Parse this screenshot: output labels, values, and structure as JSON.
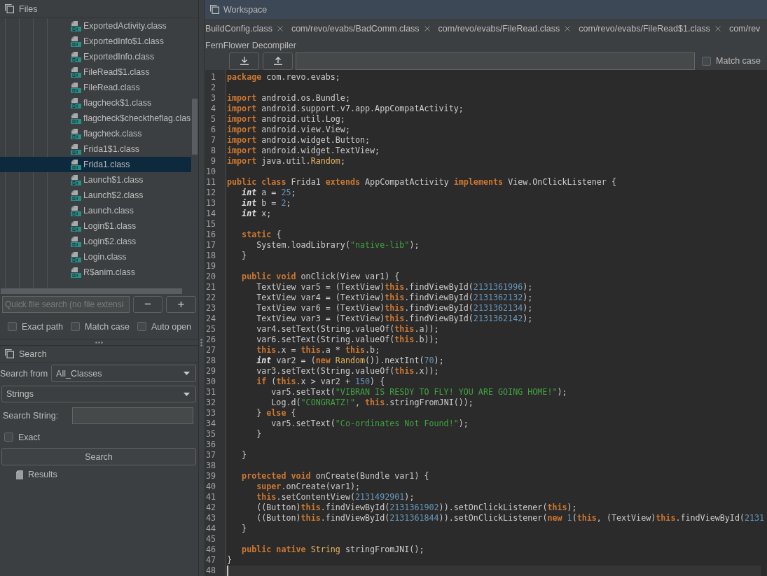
{
  "files_panel": {
    "title": "Files",
    "tree_items": [
      {
        "label": "ExportedActivity.class",
        "selected": false
      },
      {
        "label": "ExportedInfo$1.class",
        "selected": false
      },
      {
        "label": "ExportedInfo.class",
        "selected": false
      },
      {
        "label": "FileRead$1.class",
        "selected": false
      },
      {
        "label": "FileRead.class",
        "selected": false
      },
      {
        "label": "flagcheck$1.class",
        "selected": false
      },
      {
        "label": "flagcheck$checktheflag.clas",
        "selected": false
      },
      {
        "label": "flagcheck.class",
        "selected": false
      },
      {
        "label": "Frida1$1.class",
        "selected": false
      },
      {
        "label": "Frida1.class",
        "selected": true
      },
      {
        "label": "Launch$1.class",
        "selected": false
      },
      {
        "label": "Launch$2.class",
        "selected": false
      },
      {
        "label": "Launch.class",
        "selected": false
      },
      {
        "label": "Login$1.class",
        "selected": false
      },
      {
        "label": "Login$2.class",
        "selected": false
      },
      {
        "label": "Login.class",
        "selected": false
      },
      {
        "label": "R$anim.class",
        "selected": false
      }
    ],
    "quick_search": {
      "placeholder": "Quick file search (no file extensi"
    },
    "minus_button": "−",
    "plus_button": "+",
    "options": [
      {
        "label": "Exact path",
        "checked": false
      },
      {
        "label": "Match case",
        "checked": false
      },
      {
        "label": "Auto open",
        "checked": false
      }
    ]
  },
  "search_panel": {
    "title": "Search",
    "search_from": {
      "label": "Search from",
      "value": "All_Classes"
    },
    "search_type": {
      "value": "Strings"
    },
    "search_string": {
      "label": "Search String:"
    },
    "exact": {
      "label": "Exact",
      "checked": false
    },
    "search_button": "Search",
    "results": {
      "label": "Results"
    }
  },
  "workspace": {
    "title": "Workspace",
    "tabs": [
      {
        "label": "BuildConfig.class",
        "selected": false,
        "closable": true
      },
      {
        "label": "com/revo/evabs/BadComm.class",
        "selected": false,
        "closable": true
      },
      {
        "label": "com/revo/evabs/FileRead.class",
        "selected": false,
        "closable": true
      },
      {
        "label": "com/revo/evabs/FileRead$1.class",
        "selected": false,
        "closable": true
      },
      {
        "label": "com/rev",
        "selected": false,
        "closable": false
      }
    ],
    "decompiler": "FernFlower Decompiler",
    "match_case": {
      "label": "Match case",
      "checked": false
    },
    "code_lines": [
      {
        "number": "1",
        "current": false,
        "segments": [
          {
            "kind": "keyword",
            "text": "package"
          },
          {
            "kind": "plain",
            "text": " com.revo.evabs;"
          }
        ]
      },
      {
        "number": "2",
        "current": false
      },
      {
        "number": "3",
        "current": false,
        "segments": [
          {
            "kind": "keyword",
            "text": "import"
          },
          {
            "kind": "plain",
            "text": " android.os.Bundle;"
          }
        ]
      },
      {
        "number": "4",
        "current": false,
        "segments": [
          {
            "kind": "keyword",
            "text": "import"
          },
          {
            "kind": "plain",
            "text": " android.support.v7.app.AppCompatActivity;"
          }
        ]
      },
      {
        "number": "5",
        "current": false,
        "segments": [
          {
            "kind": "keyword",
            "text": "import"
          },
          {
            "kind": "plain",
            "text": " android.util.Log;"
          }
        ]
      },
      {
        "number": "6",
        "current": false,
        "segments": [
          {
            "kind": "keyword",
            "text": "import"
          },
          {
            "kind": "plain",
            "text": " android.view.View;"
          }
        ]
      },
      {
        "number": "7",
        "current": false,
        "segments": [
          {
            "kind": "keyword",
            "text": "import"
          },
          {
            "kind": "plain",
            "text": " android.widget.Button;"
          }
        ]
      },
      {
        "number": "8",
        "current": false,
        "segments": [
          {
            "kind": "keyword",
            "text": "import"
          },
          {
            "kind": "plain",
            "text": " android.widget.TextView;"
          }
        ]
      },
      {
        "number": "9",
        "current": false,
        "segments": [
          {
            "kind": "keyword",
            "text": "import"
          },
          {
            "kind": "plain",
            "text": " java.util."
          },
          {
            "kind": "class",
            "text": "Random"
          },
          {
            "kind": "plain",
            "text": ";"
          }
        ]
      },
      {
        "number": "10",
        "current": false
      },
      {
        "number": "11",
        "current": false,
        "segments": [
          {
            "kind": "keyword",
            "text": "public class"
          },
          {
            "kind": "plain",
            "text": " Frida1 "
          },
          {
            "kind": "keyword",
            "text": "extends"
          },
          {
            "kind": "plain",
            "text": " AppCompatActivity "
          },
          {
            "kind": "keyword",
            "text": "implements"
          },
          {
            "kind": "plain",
            "text": " View.OnClickListener {"
          }
        ]
      },
      {
        "number": "12",
        "current": false,
        "segments": [
          {
            "kind": "primitive",
            "text": "   int"
          },
          {
            "kind": "plain",
            "text": " a = "
          },
          {
            "kind": "number",
            "text": "25"
          },
          {
            "kind": "plain",
            "text": ";"
          }
        ]
      },
      {
        "number": "13",
        "current": false,
        "segments": [
          {
            "kind": "primitive",
            "text": "   int"
          },
          {
            "kind": "plain",
            "text": " b = "
          },
          {
            "kind": "number",
            "text": "2"
          },
          {
            "kind": "plain",
            "text": ";"
          }
        ]
      },
      {
        "number": "14",
        "current": false,
        "segments": [
          {
            "kind": "primitive",
            "text": "   int"
          },
          {
            "kind": "plain",
            "text": " x;"
          }
        ]
      },
      {
        "number": "15",
        "current": false
      },
      {
        "number": "16",
        "current": false,
        "segments": [
          {
            "kind": "keyword",
            "text": "   static"
          },
          {
            "kind": "plain",
            "text": " {"
          }
        ]
      },
      {
        "number": "17",
        "current": false,
        "segments": [
          {
            "kind": "plain",
            "text": "      System.loadLibrary("
          },
          {
            "kind": "string",
            "text": "\"native-lib\""
          },
          {
            "kind": "plain",
            "text": ");"
          }
        ]
      },
      {
        "number": "18",
        "current": false,
        "segments": [
          {
            "kind": "plain",
            "text": "   }"
          }
        ]
      },
      {
        "number": "19",
        "current": false
      },
      {
        "number": "20",
        "current": false,
        "segments": [
          {
            "kind": "keyword",
            "text": "   public void"
          },
          {
            "kind": "plain",
            "text": " onClick(View var1) {"
          }
        ]
      },
      {
        "number": "21",
        "current": false,
        "segments": [
          {
            "kind": "plain",
            "text": "      TextView var5 = (TextView)"
          },
          {
            "kind": "keyword",
            "text": "this"
          },
          {
            "kind": "plain",
            "text": ".findViewById("
          },
          {
            "kind": "number",
            "text": "2131361996"
          },
          {
            "kind": "plain",
            "text": ");"
          }
        ]
      },
      {
        "number": "22",
        "current": false,
        "segments": [
          {
            "kind": "plain",
            "text": "      TextView var4 = (TextView)"
          },
          {
            "kind": "keyword",
            "text": "this"
          },
          {
            "kind": "plain",
            "text": ".findViewById("
          },
          {
            "kind": "number",
            "text": "2131362132"
          },
          {
            "kind": "plain",
            "text": ");"
          }
        ]
      },
      {
        "number": "23",
        "current": false,
        "segments": [
          {
            "kind": "plain",
            "text": "      TextView var6 = (TextView)"
          },
          {
            "kind": "keyword",
            "text": "this"
          },
          {
            "kind": "plain",
            "text": ".findViewById("
          },
          {
            "kind": "number",
            "text": "2131362134"
          },
          {
            "kind": "plain",
            "text": ");"
          }
        ]
      },
      {
        "number": "24",
        "current": false,
        "segments": [
          {
            "kind": "plain",
            "text": "      TextView var3 = (TextView)"
          },
          {
            "kind": "keyword",
            "text": "this"
          },
          {
            "kind": "plain",
            "text": ".findViewById("
          },
          {
            "kind": "number",
            "text": "2131362142"
          },
          {
            "kind": "plain",
            "text": ");"
          }
        ]
      },
      {
        "number": "25",
        "current": false,
        "segments": [
          {
            "kind": "plain",
            "text": "      var4.setText(String.valueOf("
          },
          {
            "kind": "keyword",
            "text": "this"
          },
          {
            "kind": "plain",
            "text": ".a));"
          }
        ]
      },
      {
        "number": "26",
        "current": false,
        "segments": [
          {
            "kind": "plain",
            "text": "      var6.setText(String.valueOf("
          },
          {
            "kind": "keyword",
            "text": "this"
          },
          {
            "kind": "plain",
            "text": ".b));"
          }
        ]
      },
      {
        "number": "27",
        "current": false,
        "segments": [
          {
            "kind": "keyword",
            "text": "      this"
          },
          {
            "kind": "plain",
            "text": ".x = "
          },
          {
            "kind": "keyword",
            "text": "this"
          },
          {
            "kind": "plain",
            "text": ".a * "
          },
          {
            "kind": "keyword",
            "text": "this"
          },
          {
            "kind": "plain",
            "text": ".b;"
          }
        ]
      },
      {
        "number": "28",
        "current": false,
        "segments": [
          {
            "kind": "primitive",
            "text": "      int"
          },
          {
            "kind": "plain",
            "text": " var2 = ("
          },
          {
            "kind": "keyword",
            "text": "new"
          },
          {
            "kind": "class",
            "text": " Random"
          },
          {
            "kind": "plain",
            "text": "()).nextInt("
          },
          {
            "kind": "number",
            "text": "70"
          },
          {
            "kind": "plain",
            "text": ");"
          }
        ]
      },
      {
        "number": "29",
        "current": false,
        "segments": [
          {
            "kind": "plain",
            "text": "      var3.setText(String.valueOf("
          },
          {
            "kind": "keyword",
            "text": "this"
          },
          {
            "kind": "plain",
            "text": ".x));"
          }
        ]
      },
      {
        "number": "30",
        "current": false,
        "segments": [
          {
            "kind": "keyword",
            "text": "      if"
          },
          {
            "kind": "plain",
            "text": " ("
          },
          {
            "kind": "keyword",
            "text": "this"
          },
          {
            "kind": "plain",
            "text": ".x > var2 + "
          },
          {
            "kind": "number",
            "text": "150"
          },
          {
            "kind": "plain",
            "text": ") {"
          }
        ]
      },
      {
        "number": "31",
        "current": false,
        "segments": [
          {
            "kind": "plain",
            "text": "         var5.setText("
          },
          {
            "kind": "string",
            "text": "\"VIBRAN IS RESDY TO FLY! YOU ARE GOING HOME!\""
          },
          {
            "kind": "plain",
            "text": ");"
          }
        ]
      },
      {
        "number": "32",
        "current": false,
        "segments": [
          {
            "kind": "plain",
            "text": "         Log.d("
          },
          {
            "kind": "string",
            "text": "\"CONGRATZ!\""
          },
          {
            "kind": "plain",
            "text": ", "
          },
          {
            "kind": "keyword",
            "text": "this"
          },
          {
            "kind": "plain",
            "text": ".stringFromJNI());"
          }
        ]
      },
      {
        "number": "33",
        "current": false,
        "segments": [
          {
            "kind": "plain",
            "text": "      } "
          },
          {
            "kind": "keyword",
            "text": "else"
          },
          {
            "kind": "plain",
            "text": " {"
          }
        ]
      },
      {
        "number": "34",
        "current": false,
        "segments": [
          {
            "kind": "plain",
            "text": "         var5.setText("
          },
          {
            "kind": "string",
            "text": "\"Co-ordinates Not Found!\""
          },
          {
            "kind": "plain",
            "text": ");"
          }
        ]
      },
      {
        "number": "35",
        "current": false,
        "segments": [
          {
            "kind": "plain",
            "text": "      }"
          }
        ]
      },
      {
        "number": "36",
        "current": false
      },
      {
        "number": "37",
        "current": false,
        "segments": [
          {
            "kind": "plain",
            "text": "   }"
          }
        ]
      },
      {
        "number": "38",
        "current": false
      },
      {
        "number": "39",
        "current": false,
        "segments": [
          {
            "kind": "keyword",
            "text": "   protected void"
          },
          {
            "kind": "plain",
            "text": " onCreate(Bundle var1) {"
          }
        ]
      },
      {
        "number": "40",
        "current": false,
        "segments": [
          {
            "kind": "keyword",
            "text": "      super"
          },
          {
            "kind": "plain",
            "text": ".onCreate(var1);"
          }
        ]
      },
      {
        "number": "41",
        "current": false,
        "segments": [
          {
            "kind": "keyword",
            "text": "      this"
          },
          {
            "kind": "plain",
            "text": ".setContentView("
          },
          {
            "kind": "number",
            "text": "2131492901"
          },
          {
            "kind": "plain",
            "text": ");"
          }
        ]
      },
      {
        "number": "42",
        "current": false,
        "segments": [
          {
            "kind": "plain",
            "text": "      ((Button)"
          },
          {
            "kind": "keyword",
            "text": "this"
          },
          {
            "kind": "plain",
            "text": ".findViewById("
          },
          {
            "kind": "number",
            "text": "2131361902"
          },
          {
            "kind": "plain",
            "text": ")).setOnClickListener("
          },
          {
            "kind": "keyword",
            "text": "this"
          },
          {
            "kind": "plain",
            "text": ");"
          }
        ]
      },
      {
        "number": "43",
        "current": false,
        "segments": [
          {
            "kind": "plain",
            "text": "      ((Button)"
          },
          {
            "kind": "keyword",
            "text": "this"
          },
          {
            "kind": "plain",
            "text": ".findViewById("
          },
          {
            "kind": "number",
            "text": "2131361844"
          },
          {
            "kind": "plain",
            "text": ")).setOnClickListener("
          },
          {
            "kind": "keyword",
            "text": "new"
          },
          {
            "kind": "number",
            "text": " 1"
          },
          {
            "kind": "plain",
            "text": "("
          },
          {
            "kind": "keyword",
            "text": "this"
          },
          {
            "kind": "plain",
            "text": ", (TextView)"
          },
          {
            "kind": "keyword",
            "text": "this"
          },
          {
            "kind": "plain",
            "text": ".findViewById("
          },
          {
            "kind": "number",
            "text": "2131"
          }
        ]
      },
      {
        "number": "44",
        "current": false,
        "segments": [
          {
            "kind": "plain",
            "text": "   }"
          }
        ]
      },
      {
        "number": "45",
        "current": false
      },
      {
        "number": "46",
        "current": false,
        "segments": [
          {
            "kind": "keyword",
            "text": "   public native"
          },
          {
            "kind": "class",
            "text": " String"
          },
          {
            "kind": "plain",
            "text": " stringFromJNI();"
          }
        ]
      },
      {
        "number": "47",
        "current": false,
        "segments": [
          {
            "kind": "plain",
            "text": "}"
          }
        ]
      },
      {
        "number": "48",
        "current": true
      }
    ]
  }
}
